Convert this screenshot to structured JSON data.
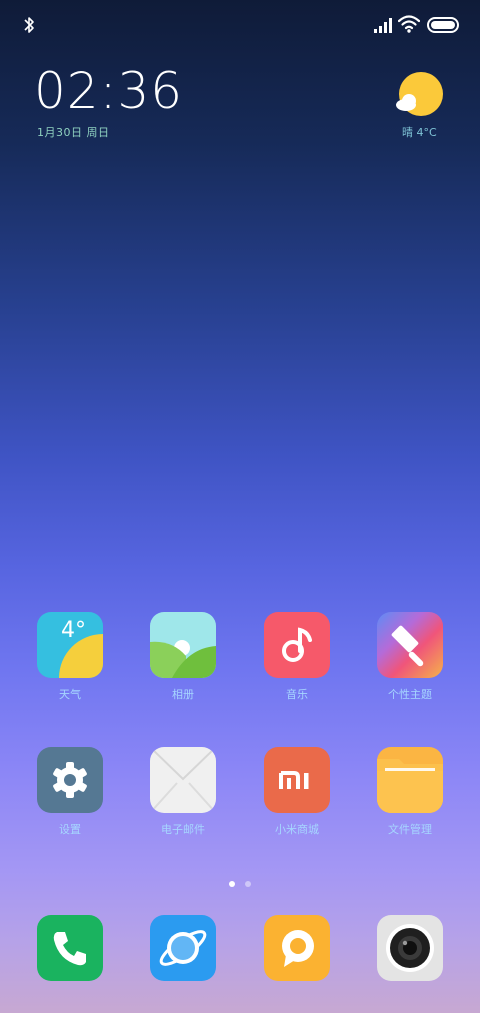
{
  "status_bar": {
    "bluetooth_icon": "bluetooth-icon",
    "signal_icon": "cell-signal-icon",
    "wifi_icon": "wifi-icon",
    "battery_icon": "battery-icon"
  },
  "clock": {
    "time": "02:36",
    "date": "1月30日 周日"
  },
  "weather": {
    "icon": "partly-cloudy-icon",
    "text": "晴 4°C"
  },
  "apps_row1": [
    {
      "label": "天气",
      "icon": "weather-app-icon",
      "temp": "4°"
    },
    {
      "label": "相册",
      "icon": "gallery-app-icon"
    },
    {
      "label": "音乐",
      "icon": "music-app-icon"
    },
    {
      "label": "个性主题",
      "icon": "themes-app-icon"
    }
  ],
  "apps_row2": [
    {
      "label": "设置",
      "icon": "settings-app-icon"
    },
    {
      "label": "电子邮件",
      "icon": "email-app-icon"
    },
    {
      "label": "小米商城",
      "icon": "mi-store-app-icon",
      "logo_text": "mi"
    },
    {
      "label": "文件管理",
      "icon": "file-manager-app-icon"
    }
  ],
  "dock": [
    {
      "icon": "phone-app-icon"
    },
    {
      "icon": "browser-app-icon"
    },
    {
      "icon": "messaging-app-icon"
    },
    {
      "icon": "camera-app-icon"
    }
  ],
  "page_indicator": {
    "pages": 2,
    "active": 1
  },
  "colors": {
    "weather_tile": "#35bfe0",
    "gallery_tile": "#9fe7ea",
    "music_tile": "#f6596a",
    "settings_tile": "#557893",
    "mi_store_tile": "#ea6a4a",
    "files_tile": "#fbb543",
    "phone_tile": "#1ab35f",
    "browser_tile": "#2b9bf0",
    "messaging_tile": "#fbb231",
    "camera_tile": "#e4e4e4"
  }
}
